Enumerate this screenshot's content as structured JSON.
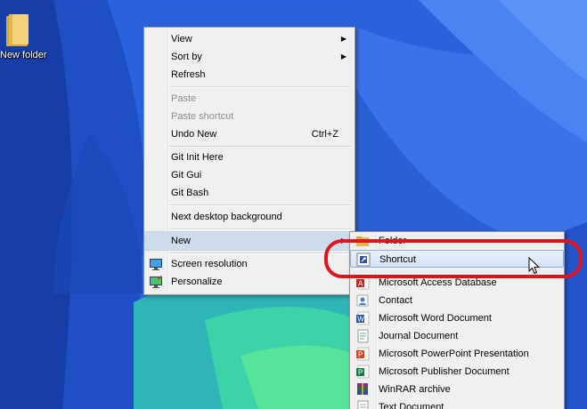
{
  "desktop": {
    "icon_label": "New folder"
  },
  "context_menu": {
    "items": [
      {
        "label": "View",
        "submenu": true
      },
      {
        "label": "Sort by",
        "submenu": true
      },
      {
        "label": "Refresh"
      },
      {
        "label": "Paste",
        "disabled": true
      },
      {
        "label": "Paste shortcut",
        "disabled": true
      },
      {
        "label": "Undo New",
        "shortcut": "Ctrl+Z"
      },
      {
        "label": "Git Init Here"
      },
      {
        "label": "Git Gui"
      },
      {
        "label": "Git Bash"
      },
      {
        "label": "Next desktop background"
      },
      {
        "label": "New",
        "submenu": true,
        "active": true
      },
      {
        "label": "Screen resolution",
        "icon": "monitor-icon"
      },
      {
        "label": "Personalize",
        "icon": "personalize-icon"
      }
    ]
  },
  "new_submenu": {
    "items": [
      {
        "label": "Folder",
        "icon": "folder-icon"
      },
      {
        "label": "Shortcut",
        "icon": "shortcut-icon",
        "hover": true
      },
      {
        "label": "Microsoft Access Database",
        "icon": "access-icon"
      },
      {
        "label": "Contact",
        "icon": "contact-icon"
      },
      {
        "label": "Microsoft Word Document",
        "icon": "word-icon"
      },
      {
        "label": "Journal Document",
        "icon": "journal-icon"
      },
      {
        "label": "Microsoft PowerPoint Presentation",
        "icon": "powerpoint-icon"
      },
      {
        "label": "Microsoft Publisher Document",
        "icon": "publisher-icon"
      },
      {
        "label": "WinRAR archive",
        "icon": "winrar-icon"
      },
      {
        "label": "Text Document",
        "icon": "text-document-icon"
      }
    ]
  },
  "colors": {
    "annotation": "#e0141e",
    "menu_bg": "#f0f0f0",
    "hover_border": "#8fb0dc"
  }
}
